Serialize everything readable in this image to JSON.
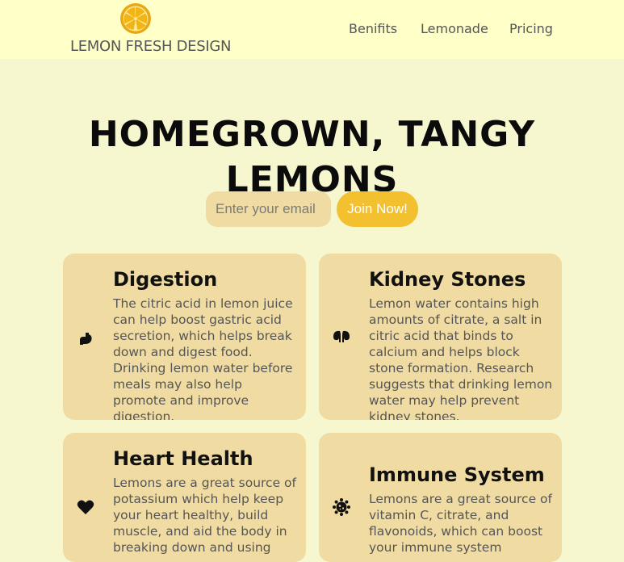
{
  "brand": {
    "name": "LEMON FRESH DESIGN",
    "logo_icon": "lemon-slice-icon",
    "colors": {
      "lemon": "#f3c02f",
      "rind": "#e9a812"
    }
  },
  "nav": {
    "items": [
      {
        "label": "Benifits"
      },
      {
        "label": "Lemonade"
      },
      {
        "label": "Pricing"
      }
    ]
  },
  "hero": {
    "title": "HOMEGROWN, TANGY LEMONS",
    "email_placeholder": "Enter your email",
    "join_label": "Join Now!"
  },
  "benefits": [
    {
      "title": "Digestion",
      "icon": "stomach-icon",
      "text": "The citric acid in lemon juice can help boost gastric acid secretion, which helps break down and digest food. Drinking lemon water before meals may also help promote and improve digestion."
    },
    {
      "title": "Kidney Stones",
      "icon": "kidneys-icon",
      "text": "Lemon water contains high amounts of citrate, a salt in citric acid that binds to calcium and helps block stone formation. Research suggests that drinking lemon water may help prevent kidney stones."
    },
    {
      "title": "Heart Health",
      "icon": "heart-icon",
      "text": "Lemons are a great source of potassium which help keep your heart healthy, build muscle, and aid the body in breaking down and using"
    },
    {
      "title": "Immune System",
      "icon": "virus-icon",
      "text": "Lemons are a great source of vitamin C, citrate, and flavonoids, which can boost your immune system"
    }
  ],
  "colors": {
    "page_bg": "#f7f7cf",
    "header_bg": "#ffffc8",
    "card_bg": "#f0dca3",
    "button_bg": "#f3c02f",
    "text_muted": "#555555"
  }
}
